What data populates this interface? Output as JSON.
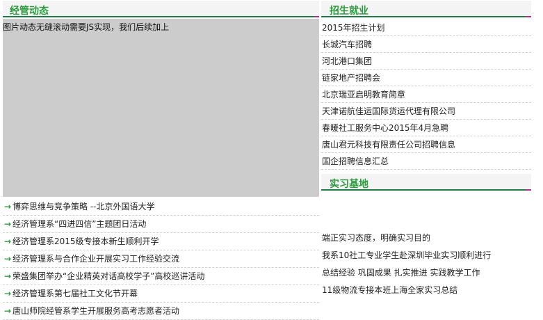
{
  "left_panel": {
    "title": "经管动态",
    "slider_placeholder": "图片动态无缝滚动需要JS实现，我们后续加上",
    "news": [
      "博弈思维与竞争策略 --北京外国语大学",
      "经济管理系“四进四信”主题团日活动",
      "经济管理系2015级专接本新生顺利开学",
      "经济管理系与合作企业开展实习工作经验交流",
      "荣盛集团举办“企业精英对话高校学子”高校巡讲活动",
      "经济管理系第七届社工文化节开幕",
      "唐山师院经管系学生开展服务高考志愿者活动"
    ]
  },
  "jobs_panel": {
    "title": "招生就业",
    "items": [
      "2015年招生计划",
      "长城汽车招聘",
      "河北港口集团",
      "链家地产招聘会",
      "北京瑞亚启明教育简章",
      "天津诺航佳运国际货运代理有限公司",
      "春暖社工服务中心2015年4月急聘",
      "唐山君元科技有限责任公司招聘信息",
      "国企招聘信息汇总"
    ]
  },
  "intern_panel": {
    "title": "实习基地",
    "items": [
      "端正实习态度，明确实习目的",
      "我系10社工专业学生赴深圳毕业实习顺利进行",
      "总结经验 巩固成果 扎实推进 实践教学工作",
      "11级物流专接本班上海全家实习总结"
    ]
  },
  "colors": {
    "header_text": "#2c9a3f",
    "header_underline": "#1f7a45",
    "header_accent": "#a4348f",
    "slider_bg": "#cccccc"
  }
}
